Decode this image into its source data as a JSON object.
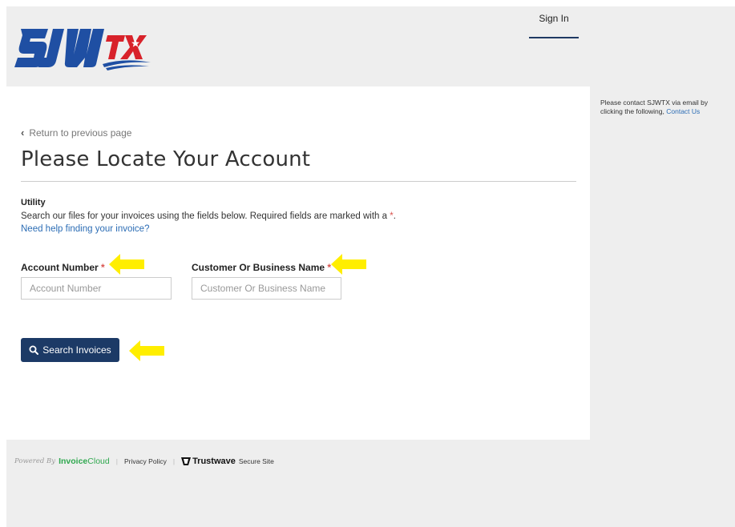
{
  "header": {
    "logo_text": "SJWTX",
    "signin_label": "Sign In"
  },
  "main": {
    "back_label": "Return to previous page",
    "title": "Please Locate Your Account",
    "section_label": "Utility",
    "instructions": "Search our files for your invoices using the fields below.  Required fields are marked with a",
    "required_mark": "*",
    "instructions_end": ".",
    "help_link": "Need help finding your invoice?",
    "fields": [
      {
        "label": "Account Number",
        "placeholder": "Account Number",
        "value": ""
      },
      {
        "label": "Customer Or Business Name",
        "placeholder": "Customer Or Business Name",
        "value": ""
      }
    ],
    "search_button": "Search Invoices"
  },
  "sidebar": {
    "note": "Please contact SJWTX via email by clicking the following,",
    "contact_link": "Contact Us"
  },
  "footer": {
    "powered_by": "Powered By",
    "invoicecloud_a": "Invoice",
    "invoicecloud_b": "Cloud",
    "privacy": "Privacy Policy",
    "trustwave": "Trustwave",
    "secure_site": "Secure Site"
  },
  "colors": {
    "primary_button": "#1c3a66",
    "link": "#2c6db5",
    "required": "#d9534f",
    "annotation_arrow": "#ffee00",
    "logo_blue": "#1f4fa3",
    "logo_red": "#d8222a"
  }
}
